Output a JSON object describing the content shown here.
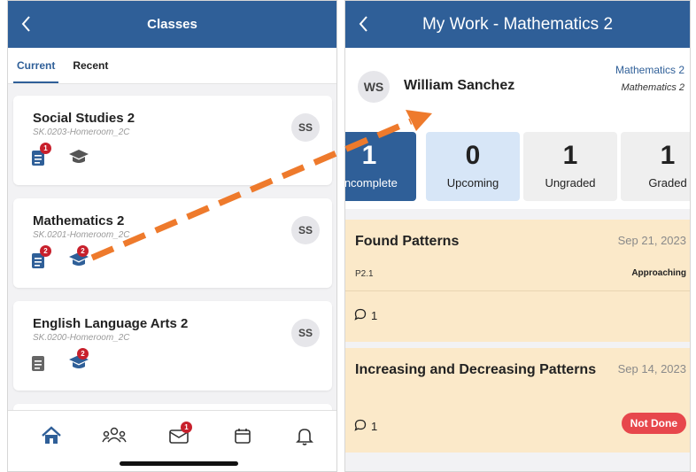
{
  "left": {
    "title": "Classes",
    "tabs": [
      {
        "label": "Current"
      },
      {
        "label": "Recent"
      }
    ],
    "classes": [
      {
        "name": "Social Studies 2",
        "code": "SK.0203-Homeroom_2C",
        "avatar": "SS",
        "assignments_badge": "1",
        "grades_badge": ""
      },
      {
        "name": "Mathematics 2",
        "code": "SK.0201-Homeroom_2C",
        "avatar": "SS",
        "assignments_badge": "2",
        "grades_badge": "2"
      },
      {
        "name": "English Language Arts 2",
        "code": "SK.0200-Homeroom_2C",
        "avatar": "SS",
        "assignments_badge": "",
        "grades_badge": "2"
      }
    ],
    "bottom_nav": {
      "items": [
        {
          "icon": "home-icon"
        },
        {
          "icon": "people-icon"
        },
        {
          "icon": "messages-icon",
          "badge": "1"
        },
        {
          "icon": "calendar-icon"
        },
        {
          "icon": "bell-icon"
        }
      ]
    }
  },
  "right": {
    "title": "My Work - Mathematics 2",
    "student": {
      "initials": "WS",
      "name": "William Sanchez",
      "subject": "Mathematics 2",
      "subject_sub": "Mathematics 2"
    },
    "stats": [
      {
        "count": "1",
        "label": "Incomplete"
      },
      {
        "count": "0",
        "label": "Upcoming"
      },
      {
        "count": "1",
        "label": "Ungraded"
      },
      {
        "count": "1",
        "label": "Graded"
      }
    ],
    "assignments": [
      {
        "title": "Found Patterns",
        "date": "Sep 21, 2023",
        "code": "P2.1",
        "level": "Approaching",
        "comments": "1"
      },
      {
        "title": "Increasing and Decreasing Patterns",
        "date": "Sep 14, 2023",
        "comments": "1",
        "status": "Not Done"
      }
    ]
  },
  "colors": {
    "primary": "#2f5f98",
    "badge": "#c8202c",
    "arrow": "#ee7a2c",
    "assignment_bg": "#fbe9c9",
    "not_done": "#e7474c"
  }
}
